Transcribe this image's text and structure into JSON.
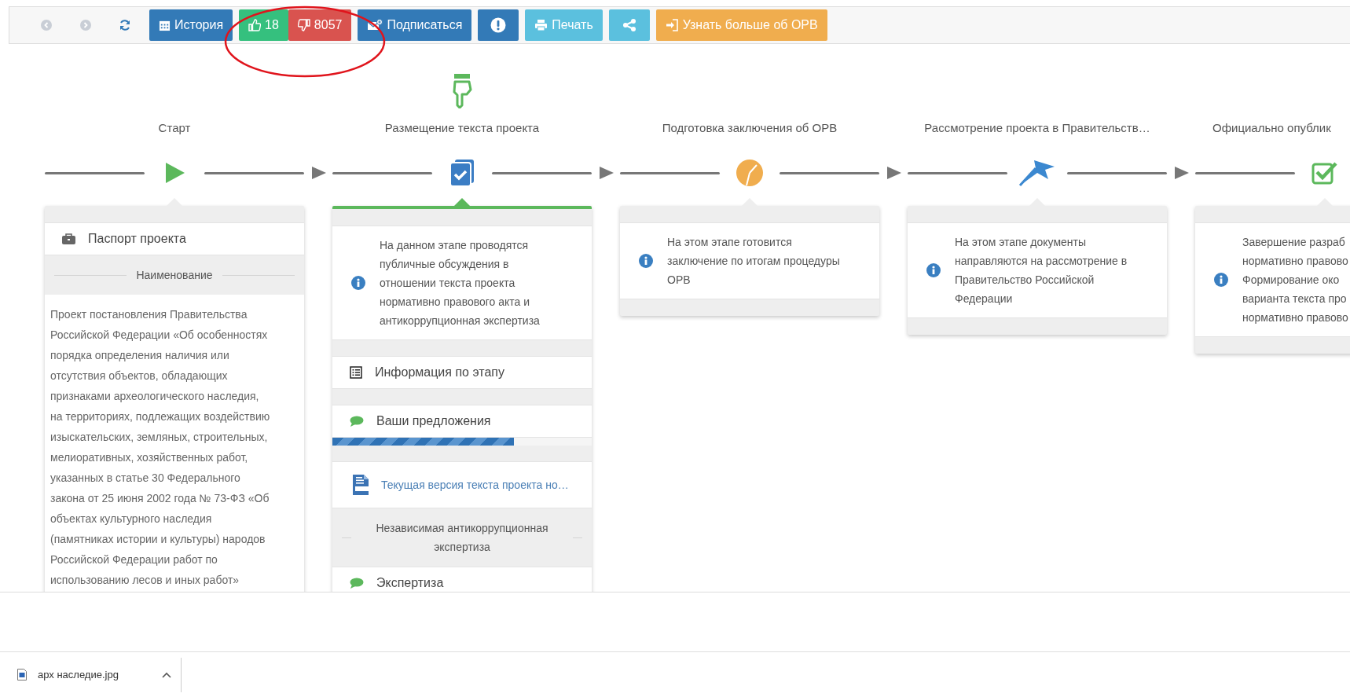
{
  "nav": [
    {
      "kind": "back",
      "disabled": true
    },
    {
      "kind": "forward",
      "disabled": true
    },
    {
      "kind": "refresh",
      "disabled": false
    }
  ],
  "buttons": [
    {
      "kind": "history",
      "label": "История"
    },
    {
      "kind": "like",
      "label": "18"
    },
    {
      "kind": "dislike",
      "label": "8057"
    },
    {
      "kind": "subscribe",
      "label": "Подписаться"
    },
    {
      "kind": "alert"
    },
    {
      "kind": "print",
      "label": "Печать"
    },
    {
      "kind": "share"
    },
    {
      "kind": "learn",
      "label": "Узнать больше об ОРВ"
    }
  ],
  "stages": [
    {
      "kind": "start",
      "title": "Старт",
      "current": false,
      "sections": [
        {
          "kind": "passport",
          "label": "Паспорт проекта"
        },
        {
          "kind": "heading",
          "label": "Наименование"
        },
        {
          "kind": "text",
          "lines": [
            "Проект постановления Правительства",
            "Российской Федерации «Об особенностях",
            "порядка определения наличия или",
            "отсутствия объектов, обладающих",
            "признаками археологического наследия,",
            "на территориях, подлежащих воздействию",
            "изыскательских, земляных, строительных,",
            "мелиоративных, хозяйственных работ,",
            "указанных в статье 30 Федерального",
            "закона от 25 июня 2002 года № 73-ФЗ «Об",
            "объектах культурного наследия",
            "(памятниках истории и культуры) народов",
            "Российской Федерации работ по",
            "использованию лесов и иных работ»"
          ]
        }
      ]
    },
    {
      "kind": "placement",
      "title": "Размещение текста проекта",
      "current": true,
      "sections": [
        {
          "kind": "info",
          "lines": [
            "На данном этапе проводятся",
            "публичные обсуждения в",
            "отношении текста проекта",
            "нормативно правового акта и",
            "антикоррупционная экспертиза"
          ]
        },
        {
          "kind": "steps",
          "label": "Информация по этапу"
        },
        {
          "kind": "comments",
          "label": "Ваши предложения"
        },
        {
          "kind": "progress",
          "level": 0.7
        },
        {
          "kind": "document",
          "label": "Текущая версия текста проекта но…"
        },
        {
          "kind": "heading",
          "label": "Независимая антикоррупционная экспертиза"
        },
        {
          "kind": "expertise",
          "label": "Экспертиза"
        }
      ]
    },
    {
      "kind": "conclusion",
      "title": "Подготовка заключения об ОРВ",
      "current": false,
      "sections": [
        {
          "kind": "info",
          "lines": [
            "На этом этапе готовится",
            "заключение по итогам процедуры",
            "ОРВ"
          ]
        }
      ]
    },
    {
      "kind": "review",
      "title": "Рассмотрение проекта в Правительств…",
      "current": false,
      "sections": [
        {
          "kind": "info",
          "lines": [
            "На этом этапе документы",
            "направляются на рассмотрение в",
            "Правительство Российской",
            "Федерации"
          ]
        }
      ]
    },
    {
      "kind": "published",
      "title": "Официально опублик",
      "current": false,
      "sections": [
        {
          "kind": "info",
          "lines": [
            "Завершение разраб",
            "нормативно правово",
            "Формирование око",
            "варианта текста про",
            "нормативно правово"
          ]
        }
      ]
    }
  ],
  "downloads": [
    {
      "name": "арх наследие.jpg"
    }
  ]
}
